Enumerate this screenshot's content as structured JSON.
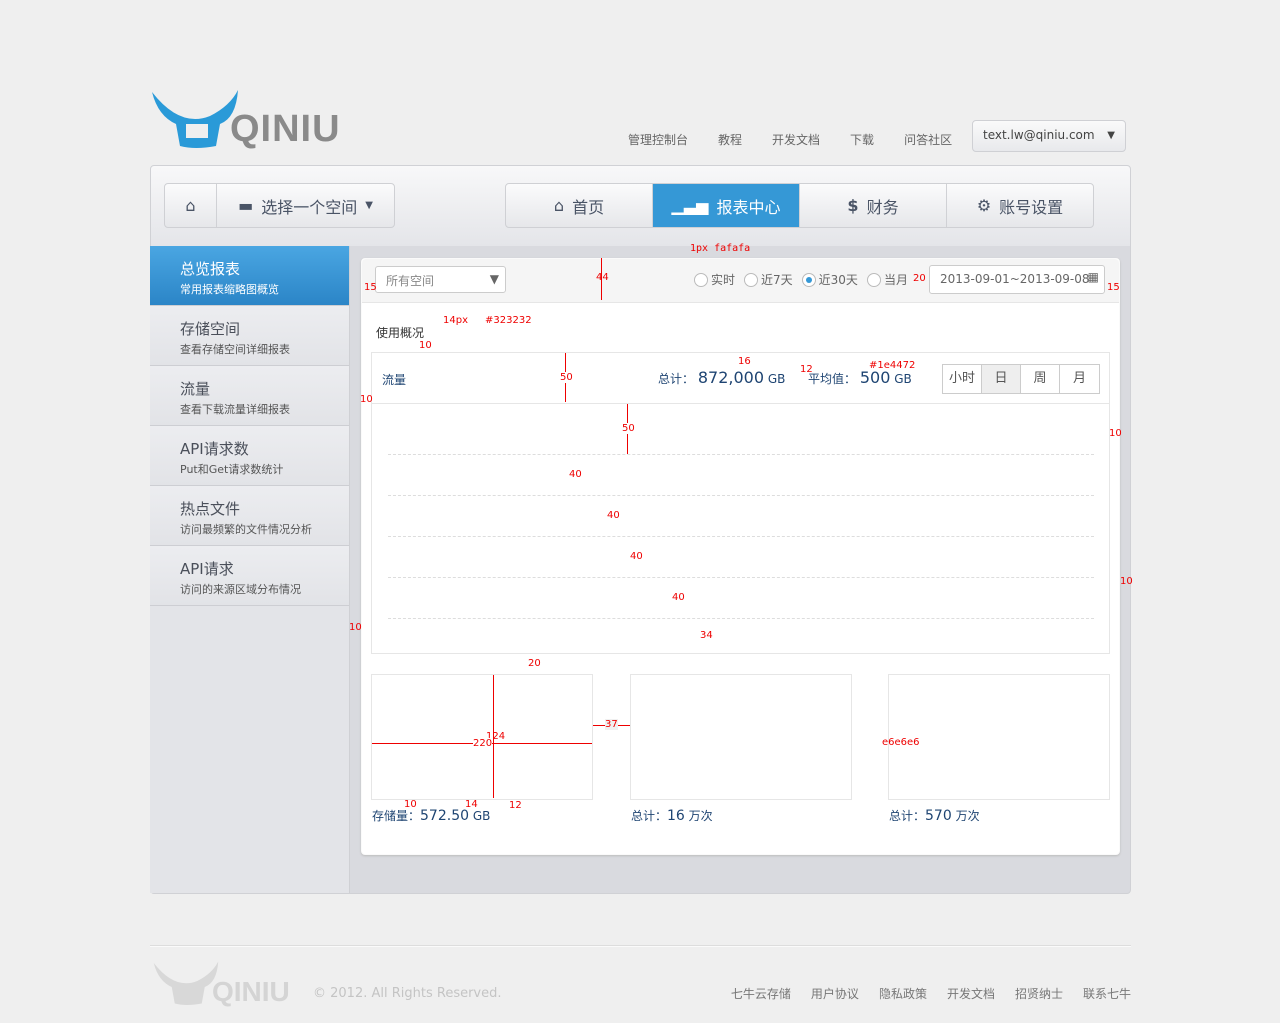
{
  "brand": {
    "name": "QINIU",
    "color": "#2a9ad8"
  },
  "top_links": [
    "管理控制台",
    "教程",
    "开发文档",
    "下载",
    "问答社区"
  ],
  "user": {
    "email": "text.lw@qiniu.com"
  },
  "space_selector": {
    "label": "选择一个空间"
  },
  "nav_tabs": [
    {
      "label": "首页",
      "icon": "home-icon"
    },
    {
      "label": "报表中心",
      "icon": "bar-chart-icon",
      "active": true
    },
    {
      "label": "财务",
      "icon": "dollar-icon"
    },
    {
      "label": "账号设置",
      "icon": "gears-icon"
    }
  ],
  "sidebar": {
    "items": [
      {
        "title": "总览报表",
        "sub": "常用报表缩略图概览",
        "active": true
      },
      {
        "title": "存储空间",
        "sub": "查看存储空间详细报表"
      },
      {
        "title": "流量",
        "sub": "查看下载流量详细报表"
      },
      {
        "title": "API请求数",
        "sub": "Put和Get请求数统计"
      },
      {
        "title": "热点文件",
        "sub": "访问最频繁的文件情况分析"
      },
      {
        "title": "API请求",
        "sub": "访问的来源区域分布情况"
      }
    ]
  },
  "filter": {
    "space_select": "所有空间",
    "ranges": [
      {
        "label": "实时"
      },
      {
        "label": "近7天"
      },
      {
        "label": "近30天",
        "selected": true
      },
      {
        "label": "当月"
      }
    ],
    "date_range": "2013-09-01~2013-09-08"
  },
  "overview": {
    "title": "使用概况"
  },
  "traffic": {
    "label": "流量",
    "total_label": "总计：",
    "total_value": "872,000",
    "total_unit": "GB",
    "avg_label": "平均值：",
    "avg_value": "500",
    "avg_unit": "GB",
    "granularity": [
      "小时",
      "日",
      "周",
      "月"
    ],
    "granularity_selected": "日"
  },
  "mini_cards": [
    {
      "label": "存储量：",
      "value": "572.50",
      "unit": "GB"
    },
    {
      "label": "总计：",
      "value": "16",
      "unit": "万次"
    },
    {
      "label": "总计：",
      "value": "570",
      "unit": "万次"
    }
  ],
  "annotations": [
    "1px fafafa",
    "44",
    "15",
    "15",
    "20",
    "14px",
    "#323232",
    "10",
    "16",
    "12",
    "#1e4472",
    "50",
    "10",
    "10",
    "50",
    "40",
    "40",
    "40",
    "40",
    "34",
    "10",
    "20",
    "124",
    "220",
    "37",
    "e6e6e6",
    "10",
    "14",
    "12",
    "10"
  ],
  "footer": {
    "copyright": "© 2012. All Rights Reserved.",
    "links": [
      "七牛云存储",
      "用户协议",
      "隐私政策",
      "开发文档",
      "招贤纳士",
      "联系七牛"
    ]
  },
  "colors": {
    "accent": "#3598d6",
    "text": "#323232",
    "value": "#1e4472",
    "border": "#e6e6e6",
    "annotation": "#ee0000"
  }
}
